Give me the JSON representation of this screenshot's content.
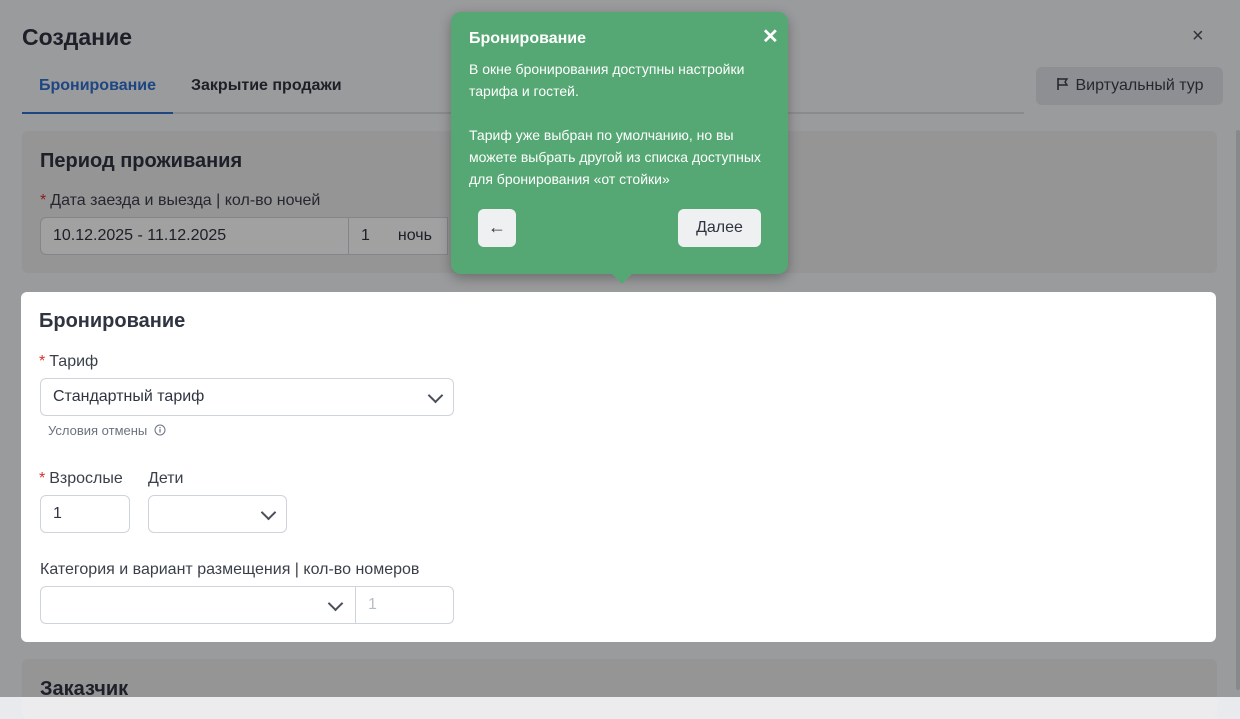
{
  "modal": {
    "title": "Создание",
    "close_symbol": "×"
  },
  "tabs": [
    {
      "label": "Бронирование",
      "active": true
    },
    {
      "label": "Закрытие продажи",
      "active": false
    }
  ],
  "virtual_tour": {
    "label": "Виртуальный тур",
    "icon": "flag-icon"
  },
  "period": {
    "title": "Период проживания",
    "dates_label": "Дата заезда и выезда | кол-во ночей",
    "dates_value": "10.12.2025 - 11.12.2025",
    "nights_value": "1",
    "nights_unit": "ночь"
  },
  "booking": {
    "title": "Бронирование",
    "tariff_label": "Тариф",
    "tariff_value": "Стандартный тариф",
    "cancel_conditions": "Условия отмены",
    "adults_label": "Взрослые",
    "adults_value": "1",
    "children_label": "Дети",
    "children_value": "",
    "category_label": "Категория и вариант размещения | кол-во номеров",
    "category_value": "",
    "rooms_placeholder": "1"
  },
  "customer": {
    "title": "Заказчик"
  },
  "required_mark": "*",
  "tooltip": {
    "title": "Бронирование",
    "close_symbol": "✕",
    "paragraph1": "В окне бронирования доступны настройки тарифа и гостей.",
    "paragraph2": "Тариф уже выбран по умолчанию, но вы можете выбрать другой из списка доступных для бронирования «от стойки»",
    "back_symbol": "←",
    "next_label": "Далее",
    "color": "#55a873"
  },
  "colors": {
    "accent": "#2e6fcf",
    "required": "#d9302a"
  }
}
